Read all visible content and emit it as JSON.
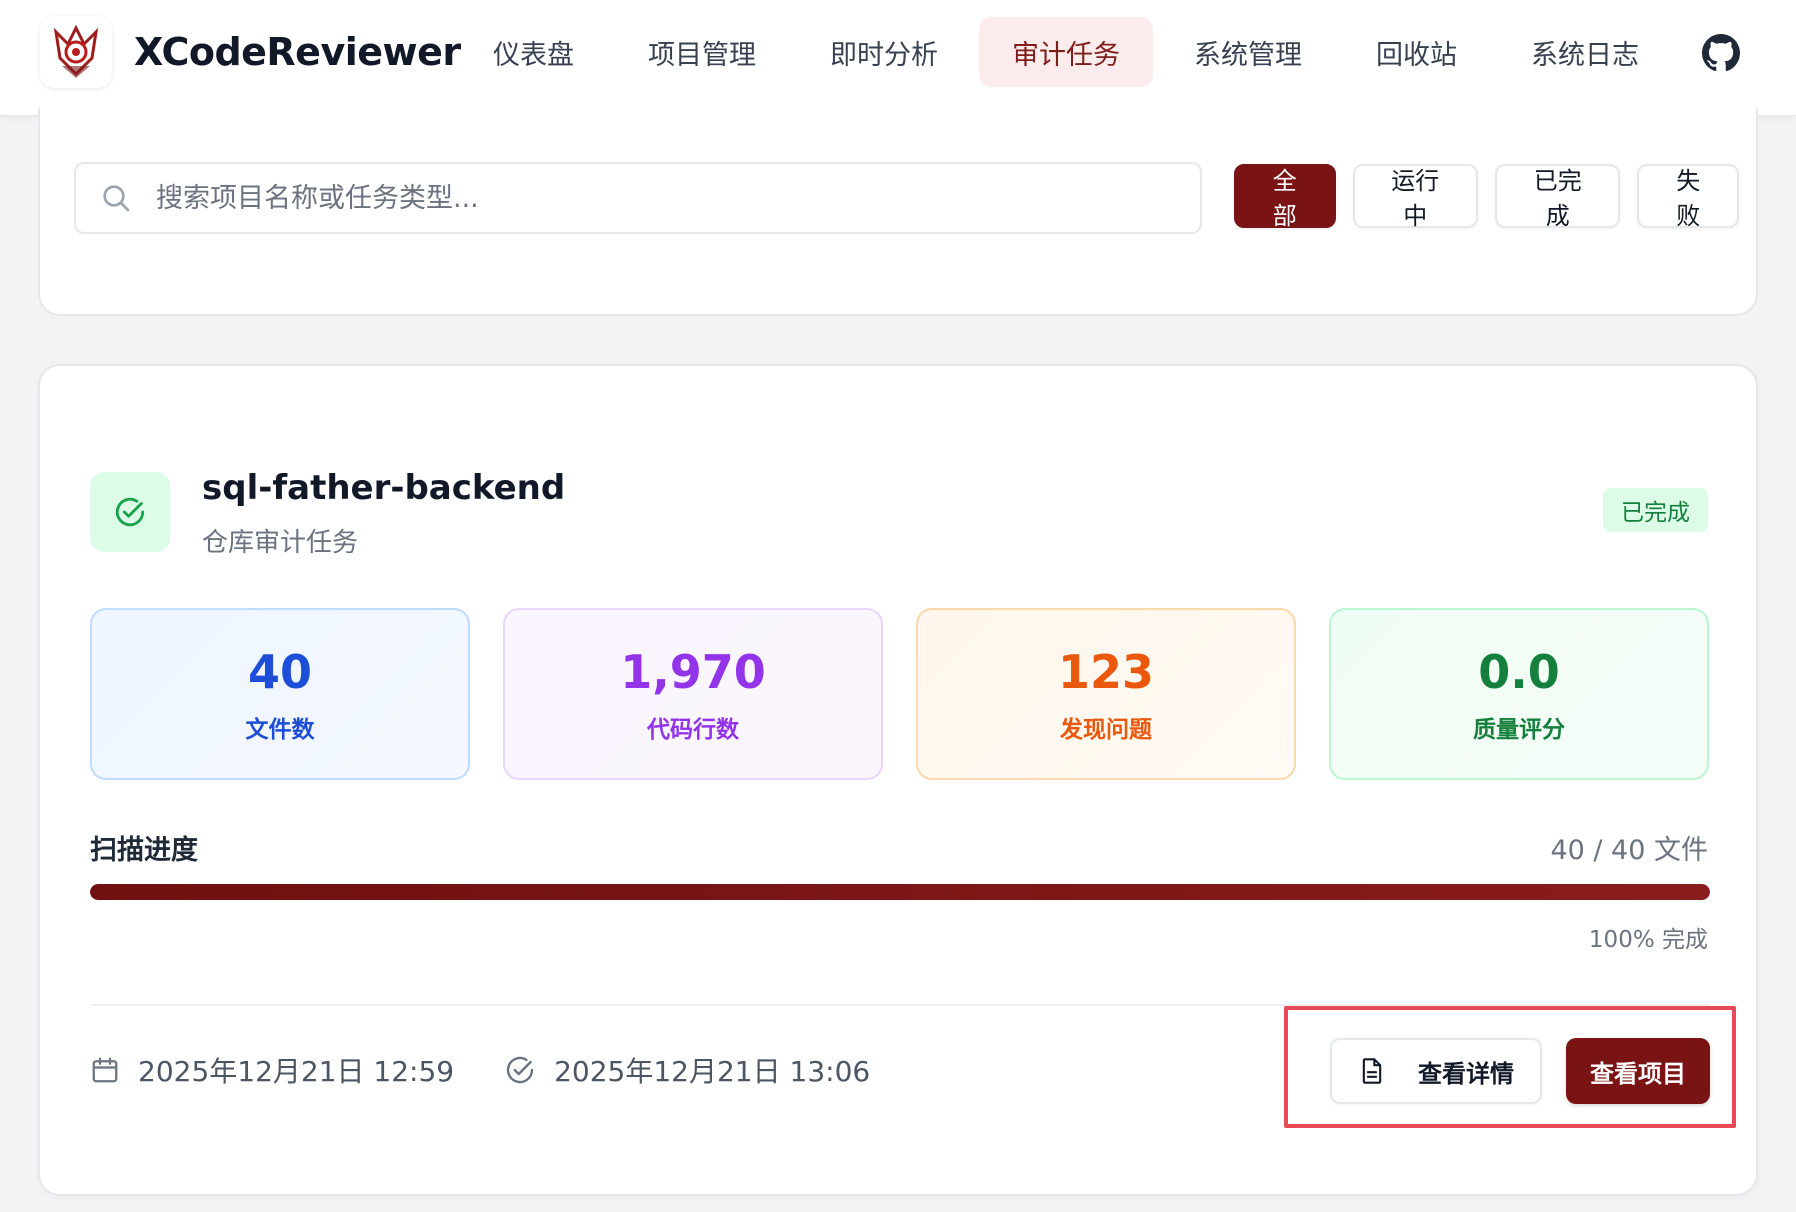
{
  "app": {
    "name": "XCodeReviewer"
  },
  "nav": {
    "items": [
      {
        "label": "仪表盘"
      },
      {
        "label": "项目管理"
      },
      {
        "label": "即时分析"
      },
      {
        "label": "审计任务",
        "active": true
      },
      {
        "label": "系统管理"
      },
      {
        "label": "回收站"
      },
      {
        "label": "系统日志"
      }
    ],
    "github_icon": "github-icon"
  },
  "search": {
    "placeholder": "搜索项目名称或任务类型..."
  },
  "filters": [
    {
      "label": "全部",
      "active": true
    },
    {
      "label": "运行中"
    },
    {
      "label": "已完成"
    },
    {
      "label": "失败"
    }
  ],
  "task": {
    "title": "sql-father-backend",
    "subtitle": "仓库审计任务",
    "status": "已完成",
    "stats": [
      {
        "value": "40",
        "label": "文件数",
        "color": "#1d4ed8"
      },
      {
        "value": "1,970",
        "label": "代码行数",
        "color": "#9333ea"
      },
      {
        "value": "123",
        "label": "发现问题",
        "color": "#ea580c"
      },
      {
        "value": "0.0",
        "label": "质量评分",
        "color": "#15803d"
      }
    ],
    "progress": {
      "label": "扫描进度",
      "count": "40 / 40 文件",
      "percent": 100,
      "percent_text": "100% 完成"
    },
    "created_at": "2025年12月21日 12:59",
    "completed_at": "2025年12月21日 13:06",
    "actions": {
      "detail": "查看详情",
      "project": "查看项目"
    }
  },
  "colors": {
    "accent": "#7a1414",
    "success": "#15803d",
    "highlight": "#e94a55"
  }
}
